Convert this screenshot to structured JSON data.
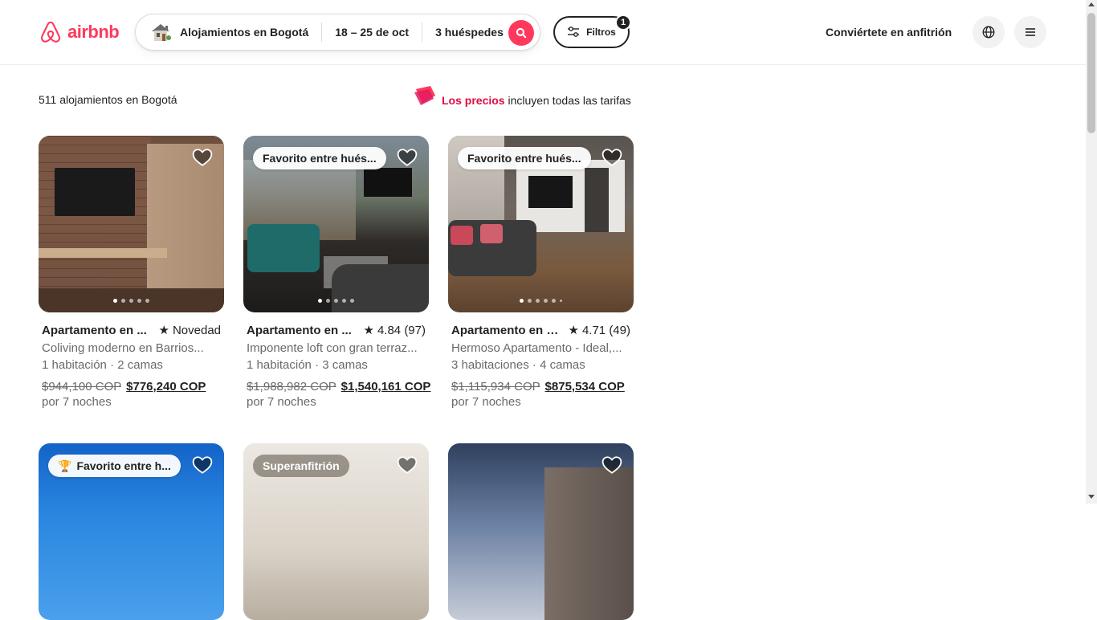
{
  "header": {
    "logo_text": "airbnb",
    "search": {
      "location": "Alojamientos en Bogotá",
      "dates": "18 – 25 de oct",
      "guests": "3 huéspedes"
    },
    "filters_label": "Filtros",
    "filters_count": "1",
    "host_link": "Conviértete en anfitrión"
  },
  "results": {
    "count_text": "511 alojamientos en Bogotá",
    "price_note_pink": "Los precios",
    "price_note_rest": " incluyen todas las tarifas"
  },
  "colors": {
    "brand": "#ff385c"
  },
  "listings": [
    {
      "badge": "",
      "title": "Apartamento en ...",
      "rating": "Novedad",
      "description": "Coliving moderno en Barrios...",
      "rooms": "1 habitación · 2 camas",
      "old_price": "$944,100 COP",
      "new_price": "$776,240 COP",
      "per": "por 7 noches"
    },
    {
      "badge": "Favorito entre hués...",
      "title": "Apartamento en ...",
      "rating": "4.84 (97)",
      "description": "Imponente loft con gran terraz...",
      "rooms": "1 habitación · 3 camas",
      "old_price": "$1,988,982 COP",
      "new_price": "$1,540,161 COP",
      "per": "por 7 noches"
    },
    {
      "badge": "Favorito entre hués...",
      "title": "Apartamento en C...",
      "rating": "4.71 (49)",
      "description": "Hermoso Apartamento - Ideal,...",
      "rooms": "3 habitaciones · 4 camas",
      "old_price": "$1,115,934 COP",
      "new_price": "$875,534 COP",
      "per": "por 7 noches"
    },
    {
      "badge": "Favorito entre h..."
    },
    {
      "badge": "Superanfitrión"
    },
    {
      "badge": ""
    }
  ]
}
